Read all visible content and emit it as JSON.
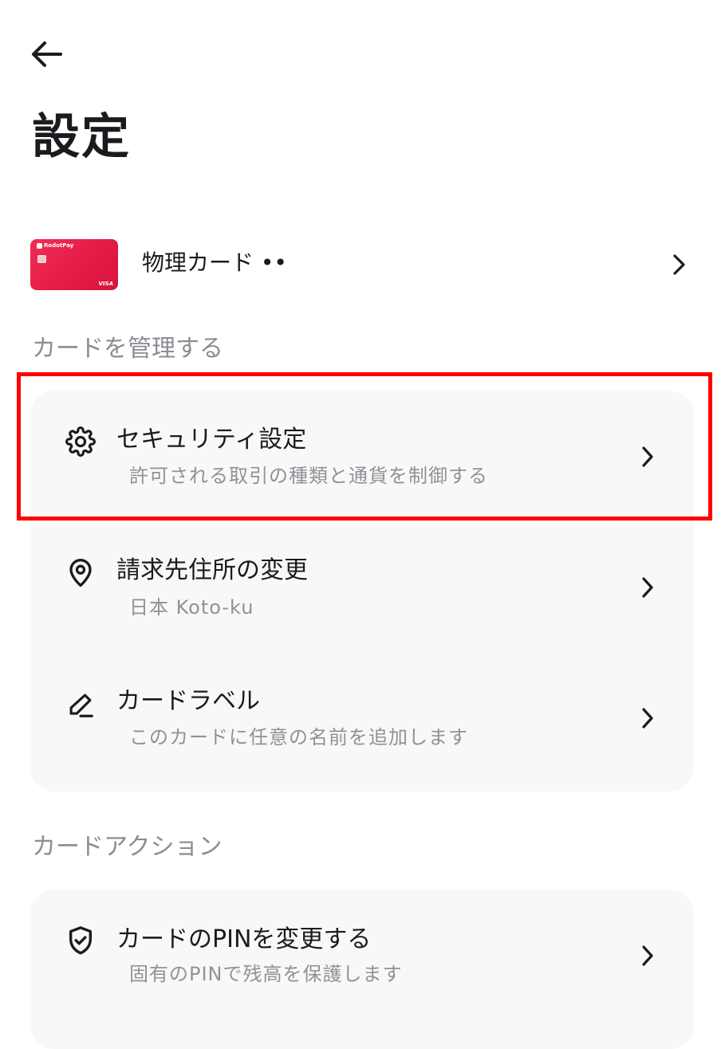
{
  "page_title": "設定",
  "card": {
    "label": "物理カード ••",
    "brand": "RedotPay",
    "network": "VISA"
  },
  "manage_section": {
    "label": "カードを管理する",
    "items": [
      {
        "icon": "gear-icon",
        "title": "セキュリティ設定",
        "subtitle": "許可される取引の種類と通貨を制御する"
      },
      {
        "icon": "location-pin-icon",
        "title": "請求先住所の変更",
        "subtitle": "日本 Koto-ku"
      },
      {
        "icon": "pencil-icon",
        "title": "カードラベル",
        "subtitle": "このカードに任意の名前を追加します"
      }
    ]
  },
  "actions_section": {
    "label": "カードアクション",
    "items": [
      {
        "icon": "shield-check-icon",
        "title": "カードのPINを変更する",
        "subtitle": "固有のPINで残高を保護します"
      }
    ]
  },
  "colors": {
    "card_accent": "#e31b44",
    "highlight": "#ff0000",
    "panel_bg": "#f8f8f8",
    "secondary_text": "#8a8d93"
  }
}
